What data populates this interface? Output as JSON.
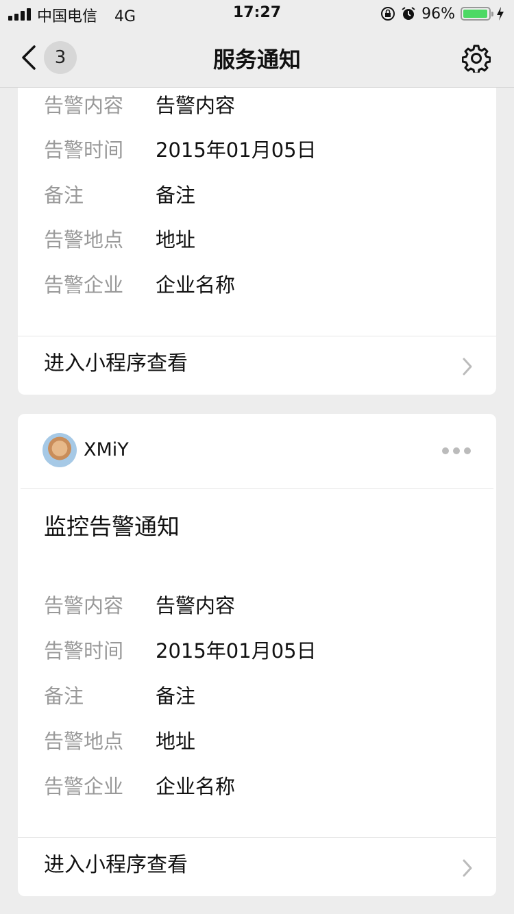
{
  "status_bar": {
    "carrier": "中国电信",
    "network": "4G",
    "time": "17:27",
    "battery_percent_label": "96%",
    "battery_level": 0.96
  },
  "nav": {
    "badge_count": "3",
    "title": "服务通知"
  },
  "icons": {
    "back": "chevron-left-icon",
    "settings": "gear-icon",
    "more": "ellipsis-icon",
    "arrow": "chevron-right-icon"
  },
  "colors": {
    "background": "#ededed",
    "card": "#ffffff",
    "label": "#999999",
    "text": "#111111",
    "battery": "#4cd964"
  },
  "cards": [
    {
      "fields": [
        {
          "label": "告警内容",
          "value": "告警内容"
        },
        {
          "label": "告警时间",
          "value": "2015年01月05日"
        },
        {
          "label": "备注",
          "value": "备注"
        },
        {
          "label": "告警地点",
          "value": "地址"
        },
        {
          "label": "告警企业",
          "value": "企业名称"
        }
      ],
      "link": "进入小程序查看"
    },
    {
      "sender": "XMiY",
      "title": "监控告警通知",
      "fields": [
        {
          "label": "告警内容",
          "value": "告警内容"
        },
        {
          "label": "告警时间",
          "value": "2015年01月05日"
        },
        {
          "label": "备注",
          "value": "备注"
        },
        {
          "label": "告警地点",
          "value": "地址"
        },
        {
          "label": "告警企业",
          "value": "企业名称"
        }
      ],
      "link": "进入小程序查看"
    }
  ]
}
